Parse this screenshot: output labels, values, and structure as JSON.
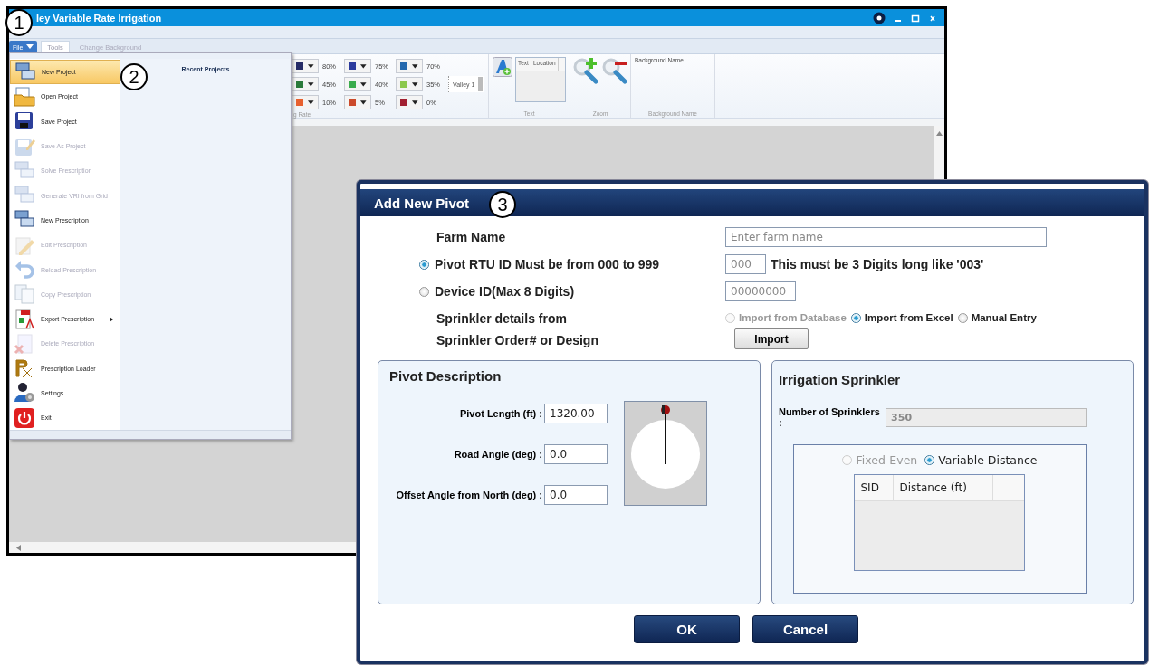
{
  "main_window": {
    "title": "ley Variable Rate Irrigation",
    "file_button": {
      "label": "File",
      "expanded": true
    },
    "tabs": [
      {
        "label": "Tools",
        "selected": true
      },
      {
        "label": "Change Background",
        "selected": false
      }
    ],
    "ribbon": {
      "swatches": [
        {
          "color": "#262c66",
          "label": "80%"
        },
        {
          "color": "#2b3a9c",
          "label": "75%"
        },
        {
          "color": "#2468ad",
          "label": "70%"
        },
        {
          "color": "#2b7a3a",
          "label": "45%"
        },
        {
          "color": "#3aac4c",
          "label": "40%"
        },
        {
          "color": "#8cc84c",
          "label": "35%"
        },
        {
          "color": "#e8602e",
          "label": "10%"
        },
        {
          "color": "#cc4a2a",
          "label": "5%"
        },
        {
          "color": "#a21f30",
          "label": "0%"
        }
      ],
      "swatch_group_label": "g Rate",
      "layer_name": "Valley 1",
      "text_columns": [
        "Text",
        "Location"
      ],
      "text_group_label": "Text",
      "zoom_group_label": "Zoom",
      "background_heading": "Background Name",
      "background_group_label": "Background Name"
    },
    "file_menu": {
      "recent_heading": "Recent Projects",
      "items": [
        {
          "label": "New Project",
          "selected": true,
          "disabled": false,
          "submenu": false
        },
        {
          "label": "Open Project",
          "selected": false,
          "disabled": false,
          "submenu": false
        },
        {
          "label": "Save Project",
          "selected": false,
          "disabled": false,
          "submenu": false
        },
        {
          "label": "Save As Project",
          "selected": false,
          "disabled": true,
          "submenu": false
        },
        {
          "label": "Solve Prescription",
          "selected": false,
          "disabled": true,
          "submenu": false
        },
        {
          "label": "Generate VRI from Grid",
          "selected": false,
          "disabled": true,
          "submenu": false
        },
        {
          "label": "New Prescription",
          "selected": false,
          "disabled": false,
          "submenu": false
        },
        {
          "label": "Edit Prescription",
          "selected": false,
          "disabled": true,
          "submenu": false
        },
        {
          "label": "Reload Prescription",
          "selected": false,
          "disabled": true,
          "submenu": false
        },
        {
          "label": "Copy Prescription",
          "selected": false,
          "disabled": true,
          "submenu": false
        },
        {
          "label": "Export Prescription",
          "selected": false,
          "disabled": false,
          "submenu": true
        },
        {
          "label": "Delete Prescription",
          "selected": false,
          "disabled": true,
          "submenu": false
        },
        {
          "label": "Prescription Loader",
          "selected": false,
          "disabled": false,
          "submenu": false
        },
        {
          "label": "Settings",
          "selected": false,
          "disabled": false,
          "submenu": false
        },
        {
          "label": "Exit",
          "selected": false,
          "disabled": false,
          "submenu": false
        }
      ]
    }
  },
  "dialog": {
    "title": "Add New Pivot",
    "farm_name": {
      "label": "Farm Name",
      "placeholder": "Enter farm name"
    },
    "id_options": [
      {
        "label": "Pivot RTU ID Must be from 000 to 999",
        "selected": true,
        "placeholder": "000",
        "hint": "This must be 3 Digits long like '003'"
      },
      {
        "label": "Device ID(Max 8 Digits)",
        "selected": false,
        "placeholder": "00000000"
      }
    ],
    "sprinkler_source": {
      "label_lines": [
        "Sprinkler details from",
        "Sprinkler Order# or Design"
      ],
      "options": [
        {
          "label": "Import from Database",
          "selected": false,
          "disabled": true
        },
        {
          "label": "Import from Excel",
          "selected": true,
          "disabled": false
        },
        {
          "label": "Manual Entry",
          "selected": false,
          "disabled": false
        }
      ],
      "button": "Import"
    },
    "pivot_description": {
      "heading": "Pivot Description",
      "fields": [
        {
          "label": "Pivot Length (ft) :",
          "value": "1320.00"
        },
        {
          "label": "Road Angle (deg) :",
          "value": "0.0"
        },
        {
          "label": "Offset Angle from North (deg) :",
          "value": "0.0"
        }
      ]
    },
    "irrigation_sprinkler": {
      "heading": "Irrigation Sprinkler",
      "count_label": "Number of Sprinklers :",
      "count_value": "350",
      "spacing_options": [
        {
          "label": "Fixed-Even",
          "selected": false,
          "disabled": true
        },
        {
          "label": "Variable Distance",
          "selected": true,
          "disabled": false
        }
      ],
      "table_columns": [
        "SID",
        "Distance (ft)"
      ]
    },
    "buttons": [
      "OK",
      "Cancel"
    ]
  },
  "callouts": [
    "1",
    "2",
    "3"
  ]
}
